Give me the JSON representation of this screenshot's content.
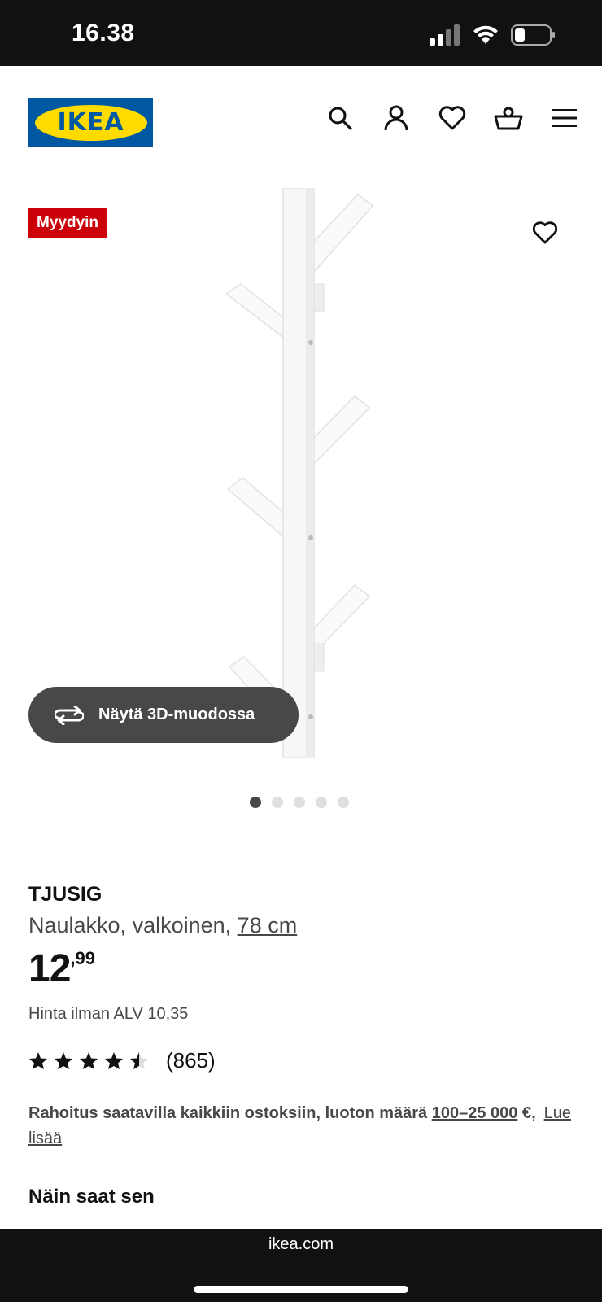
{
  "status_bar": {
    "time": "16.38"
  },
  "header": {
    "logo_text": "IKEA",
    "icons": [
      "search-icon",
      "account-icon",
      "heart-icon",
      "basket-icon",
      "menu-icon"
    ]
  },
  "product_image": {
    "badge": "Myydyin",
    "view_3d_label": "Näytä 3D-muodossa",
    "carousel": {
      "count": 5,
      "active_index": 0
    }
  },
  "product": {
    "name": "TJUSIG",
    "description": "Naulakko, valkoinen,",
    "size": "78 cm",
    "price_integer": "12",
    "price_decimal": ",99",
    "price_without_vat": "Hinta ilman ALV 10,35",
    "rating": {
      "stars": 4.5,
      "count": "(865)"
    },
    "financing": {
      "text": "Rahoitus saatavilla kaikkiin ostoksiin, luoton määrä",
      "range": "100–25 000",
      "suffix": "€,",
      "link": "Lue lisää"
    },
    "delivery_heading": "Näin saat sen"
  },
  "browser": {
    "url": "ikea.com"
  },
  "colors": {
    "badge": "#cc0008",
    "brand_blue": "#0058a3",
    "brand_yellow": "#ffdb00"
  }
}
